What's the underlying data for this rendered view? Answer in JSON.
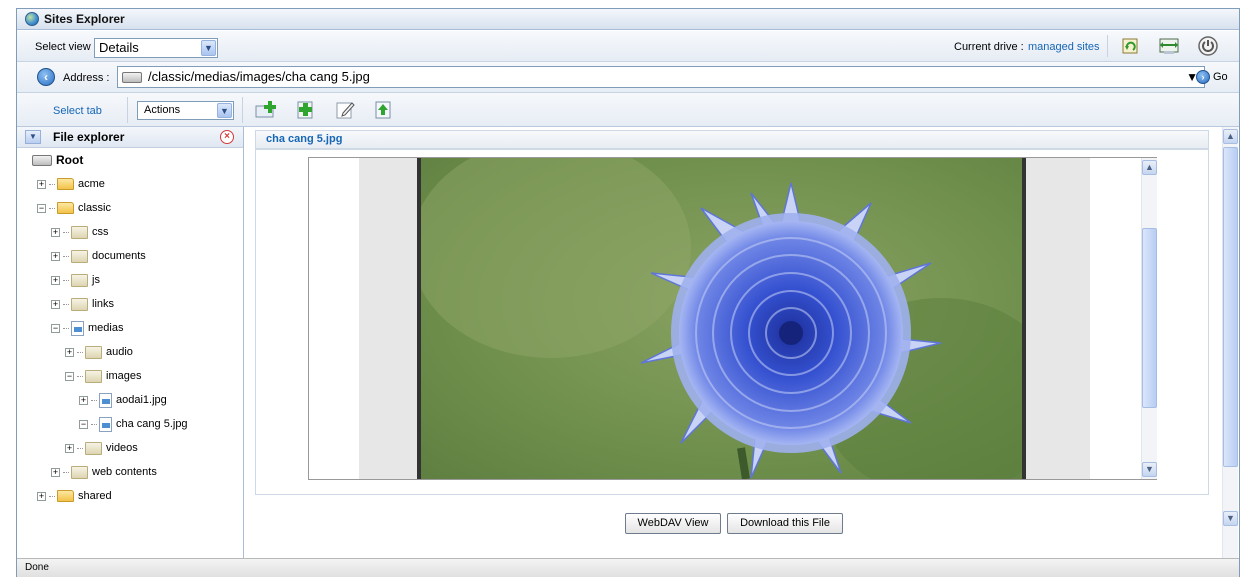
{
  "window": {
    "title": "Sites Explorer"
  },
  "view": {
    "label": "Select view",
    "selected": "Details"
  },
  "drive": {
    "label": "Current drive :",
    "value": "managed sites"
  },
  "toolbar_right_icons": [
    "refresh-icon",
    "sync-icon",
    "power-icon"
  ],
  "address": {
    "label": "Address :",
    "value": "/classic/medias/images/cha cang 5.jpg",
    "go_label": "Go"
  },
  "tabbar": {
    "select_tab": "Select tab",
    "actions_selected": "Actions"
  },
  "action_icons": [
    "add-folder-icon",
    "add-document-icon",
    "edit-icon",
    "upload-icon"
  ],
  "sidebar": {
    "title": "File explorer",
    "tree": [
      {
        "label": "Root",
        "indent": 0,
        "icon": "drive",
        "expander": "none"
      },
      {
        "label": "acme",
        "indent": 1,
        "icon": "folder",
        "expander": "plus"
      },
      {
        "label": "classic",
        "indent": 1,
        "icon": "folder",
        "expander": "minus"
      },
      {
        "label": "css",
        "indent": 2,
        "icon": "special-folder",
        "expander": "plus"
      },
      {
        "label": "documents",
        "indent": 2,
        "icon": "special-folder",
        "expander": "plus"
      },
      {
        "label": "js",
        "indent": 2,
        "icon": "special-folder",
        "expander": "plus"
      },
      {
        "label": "links",
        "indent": 2,
        "icon": "special-folder",
        "expander": "plus"
      },
      {
        "label": "medias",
        "indent": 2,
        "icon": "file",
        "expander": "minus"
      },
      {
        "label": "audio",
        "indent": 3,
        "icon": "special-folder",
        "expander": "plus"
      },
      {
        "label": "images",
        "indent": 3,
        "icon": "special-folder",
        "expander": "minus"
      },
      {
        "label": "aodai1.jpg",
        "indent": 4,
        "icon": "image-file",
        "expander": "plus"
      },
      {
        "label": "cha cang 5.jpg",
        "indent": 4,
        "icon": "image-file",
        "expander": "minus"
      },
      {
        "label": "videos",
        "indent": 3,
        "icon": "special-folder",
        "expander": "plus"
      },
      {
        "label": "web contents",
        "indent": 2,
        "icon": "special-folder",
        "expander": "plus"
      },
      {
        "label": "shared",
        "indent": 1,
        "icon": "folder",
        "expander": "plus"
      }
    ]
  },
  "content": {
    "file_title": "cha cang 5.jpg",
    "webdav_button": "WebDAV View",
    "download_button": "Download this File"
  },
  "status": {
    "text": "Done"
  }
}
